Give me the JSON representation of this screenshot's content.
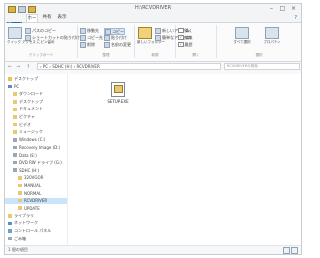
{
  "window": {
    "title": "H:\\RCVDRIVER",
    "controls": {
      "minimize": "–",
      "maximize": "□",
      "close": "×"
    }
  },
  "tabs": {
    "file": "ファイル",
    "home": "ホーム",
    "share": "共有",
    "view": "表示",
    "help": "?"
  },
  "ribbon": {
    "pin": "クイック アクセス にピン留め",
    "copy": "コピー",
    "paste": "貼り付け",
    "cut": "切り取り",
    "copy_path": "パスのコピー",
    "paste_shortcut": "ショートカットの貼り付け",
    "move_to": "移動先",
    "copy_to": "コピー先",
    "delete": "削除",
    "rename": "名前の変更",
    "new_folder": "新しいフォルダー",
    "new_item": "新しいアイテム",
    "easy_access": "簡単なアクセス",
    "properties": "プロパティ",
    "open": "開く",
    "edit": "編集",
    "history": "履歴",
    "select_all": "すべて選択",
    "select_none": "選択解除",
    "invert_selection": "選択の切り替え",
    "group_clipboard": "クリップボード",
    "group_organize": "整理",
    "group_new": "新規",
    "group_open": "開く",
    "group_select": "選択"
  },
  "address": {
    "back": "←",
    "forward": "→",
    "up": "↑",
    "path": "› PC › SDHC (H:) › RCVDRIVER",
    "search_placeholder": "RCVDRIVERの検索"
  },
  "nav": {
    "items": [
      {
        "label": "デスクトップ",
        "level": 0,
        "icon": "star"
      },
      {
        "label": "PC",
        "level": 0,
        "icon": "pc"
      },
      {
        "label": "ダウンロード",
        "level": 1,
        "icon": "folder"
      },
      {
        "label": "デスクトップ",
        "level": 1,
        "icon": "folder"
      },
      {
        "label": "ドキュメント",
        "level": 1,
        "icon": "folder"
      },
      {
        "label": "ピクチャ",
        "level": 1,
        "icon": "folder"
      },
      {
        "label": "ビデオ",
        "level": 1,
        "icon": "folder"
      },
      {
        "label": "ミュージック",
        "level": 1,
        "icon": "folder"
      },
      {
        "label": "Windows (C:)",
        "level": 1,
        "icon": "drive"
      },
      {
        "label": "Recovery Image (D:)",
        "level": 1,
        "icon": "drive"
      },
      {
        "label": "Data (E:)",
        "level": 1,
        "icon": "drive"
      },
      {
        "label": "DVD RW ドライブ (G:)",
        "level": 1,
        "icon": "drive"
      },
      {
        "label": "SDHC (H:)",
        "level": 1,
        "icon": "drive"
      },
      {
        "label": "320VGOR",
        "level": 2,
        "icon": "folder"
      },
      {
        "label": "MANUAL",
        "level": 2,
        "icon": "folder"
      },
      {
        "label": "NORMAL",
        "level": 2,
        "icon": "folder"
      },
      {
        "label": "RCVDRIVER",
        "level": 2,
        "icon": "folder",
        "selected": true
      },
      {
        "label": "UPDATE",
        "level": 2,
        "icon": "folder"
      },
      {
        "label": "ライブラリ",
        "level": 0,
        "icon": "folder"
      },
      {
        "label": "ネットワーク",
        "level": 0,
        "icon": "network"
      },
      {
        "label": "コントロール パネル",
        "level": 0,
        "icon": "panel"
      },
      {
        "label": "ごみ箱",
        "level": 0,
        "icon": "bin"
      }
    ]
  },
  "content": {
    "files": [
      {
        "name": "SETUP.EXE",
        "icon": "setup-icon"
      }
    ]
  },
  "status": {
    "text": "1 個の項目"
  },
  "colors": {
    "accent": "#1f6fb5",
    "selection": "#cce4f7"
  }
}
